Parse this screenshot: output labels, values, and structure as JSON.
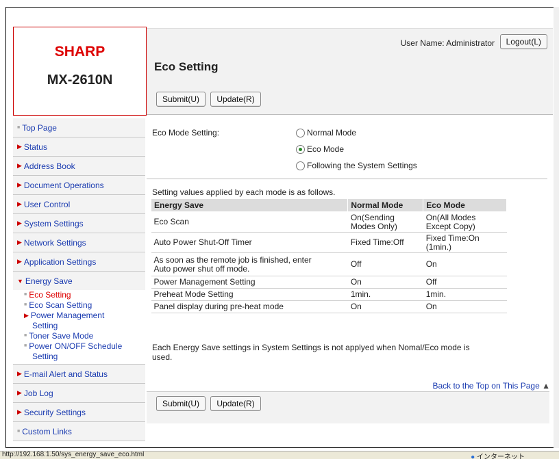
{
  "brand": {
    "logo": "SHARP",
    "model": "MX-2610N"
  },
  "header": {
    "user_label": "User Name: Administrator",
    "logout_label": "Logout(L)",
    "page_title": "Eco Setting",
    "submit_label": "Submit(U)",
    "update_label": "Update(R)"
  },
  "sidebar": {
    "top_page": "Top Page",
    "status": "Status",
    "address_book": "Address Book",
    "document_operations": "Document Operations",
    "user_control": "User Control",
    "system_settings": "System Settings",
    "network_settings": "Network Settings",
    "application_settings": "Application Settings",
    "energy_save": "Energy Save",
    "eco_setting": "Eco Setting",
    "eco_scan_setting": "Eco Scan Setting",
    "power_management_setting_1": "Power Management",
    "power_management_setting_2": "Setting",
    "toner_save_mode": "Toner Save Mode",
    "power_schedule_1": "Power ON/OFF Schedule",
    "power_schedule_2": "Setting",
    "email_alert": "E-mail Alert and Status",
    "job_log": "Job Log",
    "security_settings": "Security Settings",
    "custom_links": "Custom Links"
  },
  "eco_mode": {
    "label": "Eco Mode Setting:",
    "options": [
      "Normal Mode",
      "Eco Mode",
      "Following the System Settings"
    ],
    "selected": "Eco Mode"
  },
  "table": {
    "intro": "Setting values applied by each mode is as follows.",
    "headers": [
      "Energy Save",
      "Normal Mode",
      "Eco Mode"
    ],
    "rows": [
      {
        "name": "Eco Scan",
        "normal_1": "On(Sending",
        "normal_2": "Modes Only)",
        "eco_1": "On(All Modes",
        "eco_2": "Except Copy)"
      },
      {
        "name": "Auto Power Shut-Off Timer",
        "normal": "Fixed Time:Off",
        "eco_1": "Fixed Time:On",
        "eco_2": "(1min.)"
      },
      {
        "name_1": "As soon as the remote job is finished, enter",
        "name_2": "Auto power shut off mode.",
        "normal": "Off",
        "eco": "On"
      },
      {
        "name": "Power Management Setting",
        "normal": "On",
        "eco": "Off"
      },
      {
        "name": "Preheat Mode Setting",
        "normal": "1min.",
        "eco": "1min."
      },
      {
        "name": "Panel display during pre-heat mode",
        "normal": "On",
        "eco": "On"
      }
    ],
    "note_1": "Each Energy Save settings in System Settings is not applyed when Nomal/Eco mode is",
    "note_2": "used."
  },
  "back_to_top": "Back to the Top on This Page",
  "status_bar": {
    "url": "http://192.168.1.50/sys_energy_save_eco.html",
    "zone": "インターネット"
  }
}
